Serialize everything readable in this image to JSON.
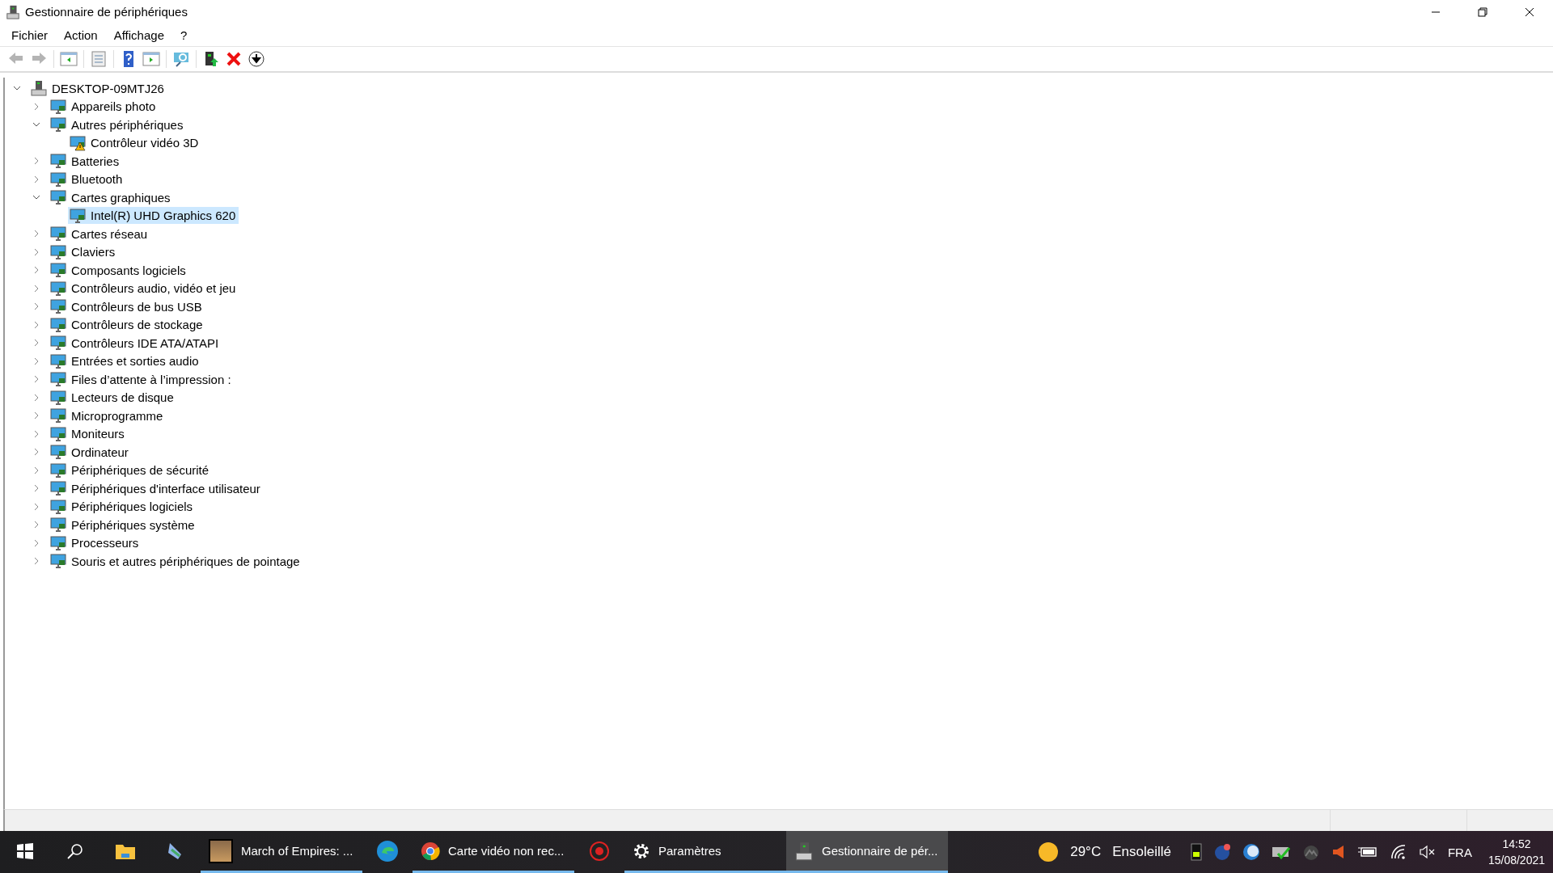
{
  "window": {
    "title": "Gestionnaire de périphériques"
  },
  "menu": [
    {
      "label": "Fichier"
    },
    {
      "label": "Action"
    },
    {
      "label": "Affichage"
    },
    {
      "label": "?"
    }
  ],
  "toolbar": [
    {
      "kind": "back",
      "disabled": true
    },
    {
      "kind": "forward",
      "disabled": true
    },
    {
      "kind": "separator"
    },
    {
      "kind": "console-tree",
      "disabled": false
    },
    {
      "kind": "separator"
    },
    {
      "kind": "properties",
      "disabled": false
    },
    {
      "kind": "separator"
    },
    {
      "kind": "help",
      "disabled": false
    },
    {
      "kind": "action-pane",
      "disabled": false
    },
    {
      "kind": "separator"
    },
    {
      "kind": "scan",
      "disabled": false
    },
    {
      "kind": "separator"
    },
    {
      "kind": "update",
      "disabled": false
    },
    {
      "kind": "uninstall",
      "disabled": false
    },
    {
      "kind": "disable",
      "disabled": false
    }
  ],
  "tree": {
    "label": "DESKTOP-09MTJ26",
    "expanded": true,
    "selected": false,
    "children": [
      {
        "label": "Appareils photo",
        "expanded": false,
        "selected": false
      },
      {
        "label": "Autres périphériques",
        "expanded": true,
        "selected": false,
        "children": [
          {
            "label": "Contrôleur vidéo 3D",
            "selected": false,
            "warning": true
          }
        ]
      },
      {
        "label": "Batteries",
        "expanded": false,
        "selected": false
      },
      {
        "label": "Bluetooth",
        "expanded": false,
        "selected": false
      },
      {
        "label": "Cartes graphiques",
        "expanded": true,
        "selected": false,
        "children": [
          {
            "label": "Intel(R) UHD Graphics 620",
            "selected": true,
            "warning": false
          }
        ]
      },
      {
        "label": "Cartes réseau",
        "expanded": false,
        "selected": false
      },
      {
        "label": "Claviers",
        "expanded": false,
        "selected": false
      },
      {
        "label": "Composants logiciels",
        "expanded": false,
        "selected": false
      },
      {
        "label": "Contrôleurs audio, vidéo et jeu",
        "expanded": false,
        "selected": false
      },
      {
        "label": "Contrôleurs de bus USB",
        "expanded": false,
        "selected": false
      },
      {
        "label": "Contrôleurs de stockage",
        "expanded": false,
        "selected": false
      },
      {
        "label": "Contrôleurs IDE ATA/ATAPI",
        "expanded": false,
        "selected": false
      },
      {
        "label": "Entrées et sorties audio",
        "expanded": false,
        "selected": false
      },
      {
        "label": "Files d’attente à l’impression :",
        "expanded": false,
        "selected": false
      },
      {
        "label": "Lecteurs de disque",
        "expanded": false,
        "selected": false
      },
      {
        "label": "Microprogramme",
        "expanded": false,
        "selected": false
      },
      {
        "label": "Moniteurs",
        "expanded": false,
        "selected": false
      },
      {
        "label": "Ordinateur",
        "expanded": false,
        "selected": false
      },
      {
        "label": "Périphériques de sécurité",
        "expanded": false,
        "selected": false
      },
      {
        "label": "Périphériques d'interface utilisateur",
        "expanded": false,
        "selected": false
      },
      {
        "label": "Périphériques logiciels",
        "expanded": false,
        "selected": false
      },
      {
        "label": "Périphériques système",
        "expanded": false,
        "selected": false
      },
      {
        "label": "Processeurs",
        "expanded": false,
        "selected": false
      },
      {
        "label": "Souris et autres périphériques de pointage",
        "expanded": false,
        "selected": false
      }
    ]
  },
  "taskbar": {
    "items": [
      {
        "kind": "start",
        "running": false,
        "active": false
      },
      {
        "kind": "search",
        "running": false,
        "active": false
      },
      {
        "kind": "explorer",
        "running": false,
        "active": false
      },
      {
        "kind": "scanner",
        "running": false,
        "active": false
      },
      {
        "kind": "game",
        "label": "March of Empires: ...",
        "running": true,
        "active": false
      },
      {
        "kind": "edge",
        "running": false,
        "active": false
      },
      {
        "kind": "chrome",
        "label": "Carte vidéo non rec...",
        "running": true,
        "active": false
      },
      {
        "kind": "redapp",
        "running": false,
        "active": false
      },
      {
        "kind": "settings",
        "label": "Paramètres",
        "running": true,
        "active": false
      },
      {
        "kind": "devmgr",
        "label": "Gestionnaire de pér...",
        "running": true,
        "active": true
      }
    ],
    "weather": {
      "temperature": "29°C",
      "condition": "Ensoleillé"
    },
    "language": "FRA",
    "time": "14:52",
    "date": "15/08/2021"
  }
}
